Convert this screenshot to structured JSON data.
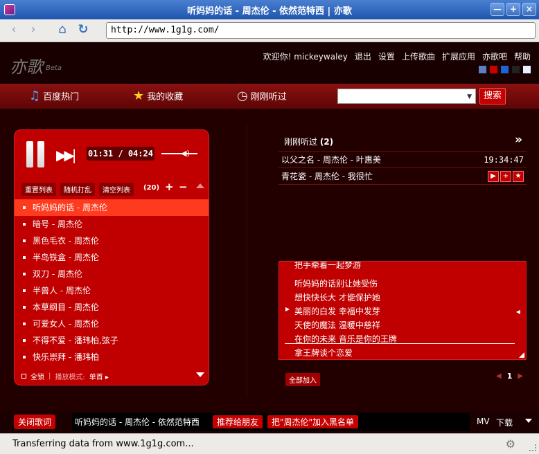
{
  "window": {
    "title": "听妈妈的话 - 周杰伦 - 依然范特西 | 亦歌"
  },
  "browser": {
    "url": "http://www.1g1g.com/",
    "status": "Transferring data from www.1g1g.com..."
  },
  "site": {
    "logo": "亦歌",
    "logo_suffix": "Beta",
    "topnav": [
      "欢迎你! mickeywaley",
      "退出",
      "设置",
      "上传歌曲",
      "扩展应用",
      "亦歌吧",
      "帮助"
    ],
    "skins": [
      "#5b7fc0",
      "#cc0000",
      "#1e63d6",
      "#222222",
      "#e8f0ff"
    ]
  },
  "categories": [
    {
      "label": "百度热门",
      "icon": "music-note-icon"
    },
    {
      "label": "我的收藏",
      "icon": "star-icon"
    },
    {
      "label": "刚刚听过",
      "icon": "clock-icon"
    }
  ],
  "search": {
    "button": "搜索",
    "value": ""
  },
  "player": {
    "time": "01:31 / 04:24",
    "controls": [
      "重置列表",
      "随机打乱",
      "清空列表"
    ],
    "count": "(20)",
    "playlist": [
      "听妈妈的话 - 周杰伦",
      "暗号 - 周杰伦",
      "黑色毛衣 - 周杰伦",
      "半岛铁盒 - 周杰伦",
      "双刀 - 周杰伦",
      "半兽人 - 周杰伦",
      "本草纲目 - 周杰伦",
      "可爱女人 - 周杰伦",
      "不得不爱 - 潘玮柏,弦子",
      "快乐崇拜 - 潘玮柏"
    ],
    "active_index": 0,
    "footer": {
      "select_all": "全锁",
      "mode_label": "播放模式:",
      "mode_value": "单首"
    }
  },
  "recent": {
    "title": "刚刚听过",
    "count": "(2)",
    "items": [
      {
        "song": "以父之名 - 周杰伦 - 叶惠美",
        "time": "19:34:47"
      },
      {
        "song": "青花瓷 - 周杰伦 - 我很忙",
        "time": ""
      }
    ],
    "add_all": "全部加入",
    "page": "1"
  },
  "lyrics": {
    "lines": [
      "把手牵着一起梦游",
      "听妈妈的话别让她受伤",
      "想快快长大 才能保护她",
      "美丽的白发 幸福中发芽",
      "天使的魔法 温暖中慈祥",
      "在你的未来 音乐是你的王牌",
      "拿王牌谈个恋爱"
    ],
    "current_index": 3
  },
  "bottom": {
    "close_lyrics": "关闭歌词",
    "now_playing": "听妈妈的话 - 周杰伦 - 依然范特西",
    "recommend": "推荐给朋友",
    "blacklist": "把\"周杰伦\"加入黑名单",
    "mv": "MV",
    "download": "下载"
  }
}
